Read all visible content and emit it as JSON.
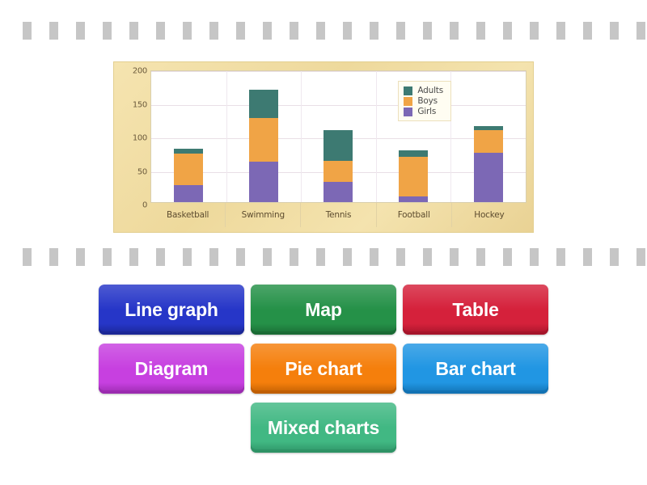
{
  "separators": {
    "dash_count": 24,
    "dash_color": "#c6c6c6"
  },
  "chart_data": {
    "type": "bar",
    "stacked": true,
    "title": "",
    "subtitle": "",
    "xlabel": "",
    "ylabel": "",
    "categories": [
      "Basketball",
      "Swimming",
      "Tennis",
      "Football",
      "Hockey"
    ],
    "series": [
      {
        "name": "Girls",
        "color": "#7c68b5",
        "values": [
          25,
          60,
          30,
          8,
          73
        ]
      },
      {
        "name": "Boys",
        "color": "#f0a446",
        "values": [
          47,
          65,
          32,
          59,
          34
        ]
      },
      {
        "name": "Adults",
        "color": "#3d7a72",
        "values": [
          8,
          43,
          45,
          10,
          6
        ]
      }
    ],
    "totals": [
      80,
      168,
      107,
      77,
      113
    ],
    "ylim": [
      0,
      200
    ],
    "yticks": [
      200,
      150,
      100,
      50,
      0
    ],
    "ytick_labels": [
      "200",
      "150",
      "100",
      "50",
      "0"
    ],
    "grid": true,
    "legend_position": "top-right",
    "legend_entries": [
      "Adults",
      "Boys",
      "Girls"
    ],
    "plot_background": "#ffffff",
    "card_background": "#f3e0a8"
  },
  "answers": {
    "rows": [
      [
        {
          "label": "Line graph",
          "color": "#2636c8",
          "shadow": "#1b2796"
        },
        {
          "label": "Map",
          "color": "#259148",
          "shadow": "#1a6b34"
        },
        {
          "label": "Table",
          "color": "#d5213b",
          "shadow": "#a6152b"
        }
      ],
      [
        {
          "label": "Diagram",
          "color": "#c740e0",
          "shadow": "#9b2bb0"
        },
        {
          "label": "Pie chart",
          "color": "#f57f0c",
          "shadow": "#c05f03"
        },
        {
          "label": "Bar chart",
          "color": "#2196e3",
          "shadow": "#1272b3"
        }
      ],
      [
        {
          "label": "Mixed charts",
          "color": "#41b883",
          "shadow": "#2e9366"
        }
      ]
    ]
  }
}
